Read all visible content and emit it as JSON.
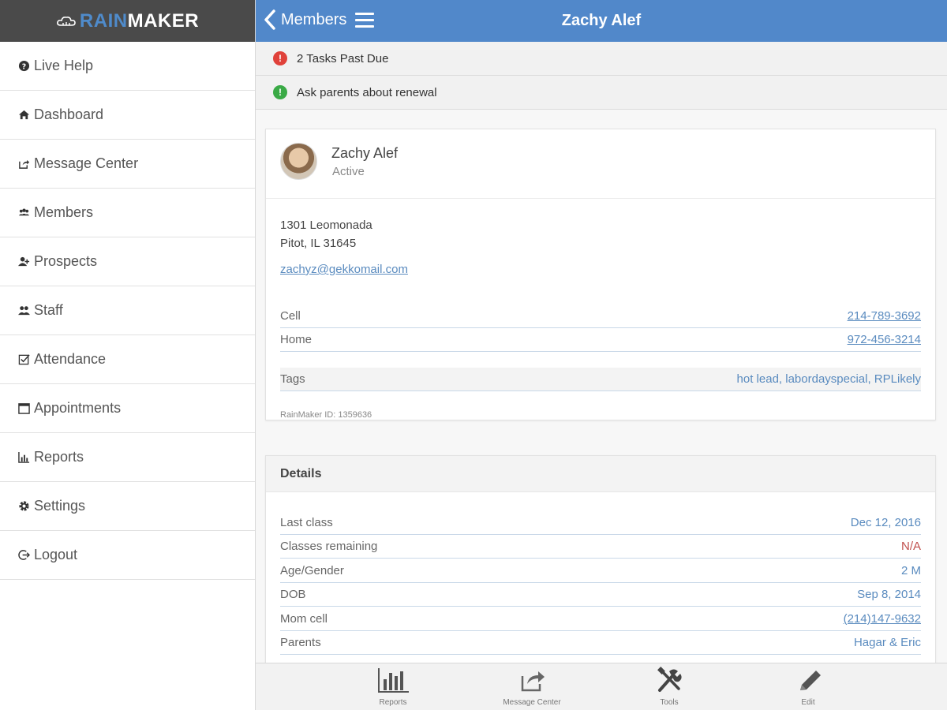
{
  "brand": {
    "rain": "RAIN",
    "maker": "MAKER"
  },
  "sidebar": {
    "items": [
      {
        "label": "Live Help",
        "icon": "question-circle-icon"
      },
      {
        "label": "Dashboard",
        "icon": "home-icon"
      },
      {
        "label": "Message Center",
        "icon": "share-icon"
      },
      {
        "label": "Members",
        "icon": "group-icon"
      },
      {
        "label": "Prospects",
        "icon": "user-plus-icon"
      },
      {
        "label": "Staff",
        "icon": "users-icon"
      },
      {
        "label": "Attendance",
        "icon": "checkbox-icon"
      },
      {
        "label": "Appointments",
        "icon": "calendar-icon"
      },
      {
        "label": "Reports",
        "icon": "bar-chart-icon"
      },
      {
        "label": "Settings",
        "icon": "gear-icon"
      },
      {
        "label": "Logout",
        "icon": "logout-icon"
      }
    ]
  },
  "topbar": {
    "back_label": "Members",
    "title": "Zachy Alef",
    "color": "#5188ca"
  },
  "alerts": [
    {
      "text": "2 Tasks Past Due",
      "icon": "!",
      "color": "#e0413a"
    },
    {
      "text": "Ask parents about renewal",
      "icon": "!",
      "color": "#3aaa46"
    }
  ],
  "profile": {
    "name": "Zachy Alef",
    "status": "Active",
    "address_line1": "1301 Leomonada",
    "address_line2": "Pitot, IL 31645",
    "email": "zachyz@gekkomail.com",
    "cell_label": "Cell",
    "cell": "214-789-3692",
    "home_label": "Home",
    "home": "972-456-3214",
    "tags_label": "Tags",
    "tags": "hot lead, labordayspecial, RPLikely",
    "rainmaker_id": "RainMaker ID: 1359636"
  },
  "details": {
    "heading": "Details",
    "rows": [
      {
        "label": "Last class",
        "value": "Dec 12, 2016"
      },
      {
        "label": "Classes remaining",
        "value": "N/A"
      },
      {
        "label": "Age/Gender",
        "value": "2 M"
      },
      {
        "label": "DOB",
        "value": "Sep 8, 2014"
      },
      {
        "label": "Mom cell",
        "value": "(214)147-9632"
      },
      {
        "label": "Parents",
        "value": "Hagar & Eric"
      }
    ]
  },
  "toolbar": {
    "items": [
      {
        "label": "Reports",
        "icon": "bar-chart-icon"
      },
      {
        "label": "Message Center",
        "icon": "share-icon"
      },
      {
        "label": "Tools",
        "icon": "tools-icon"
      },
      {
        "label": "Edit",
        "icon": "pencil-icon"
      }
    ]
  }
}
